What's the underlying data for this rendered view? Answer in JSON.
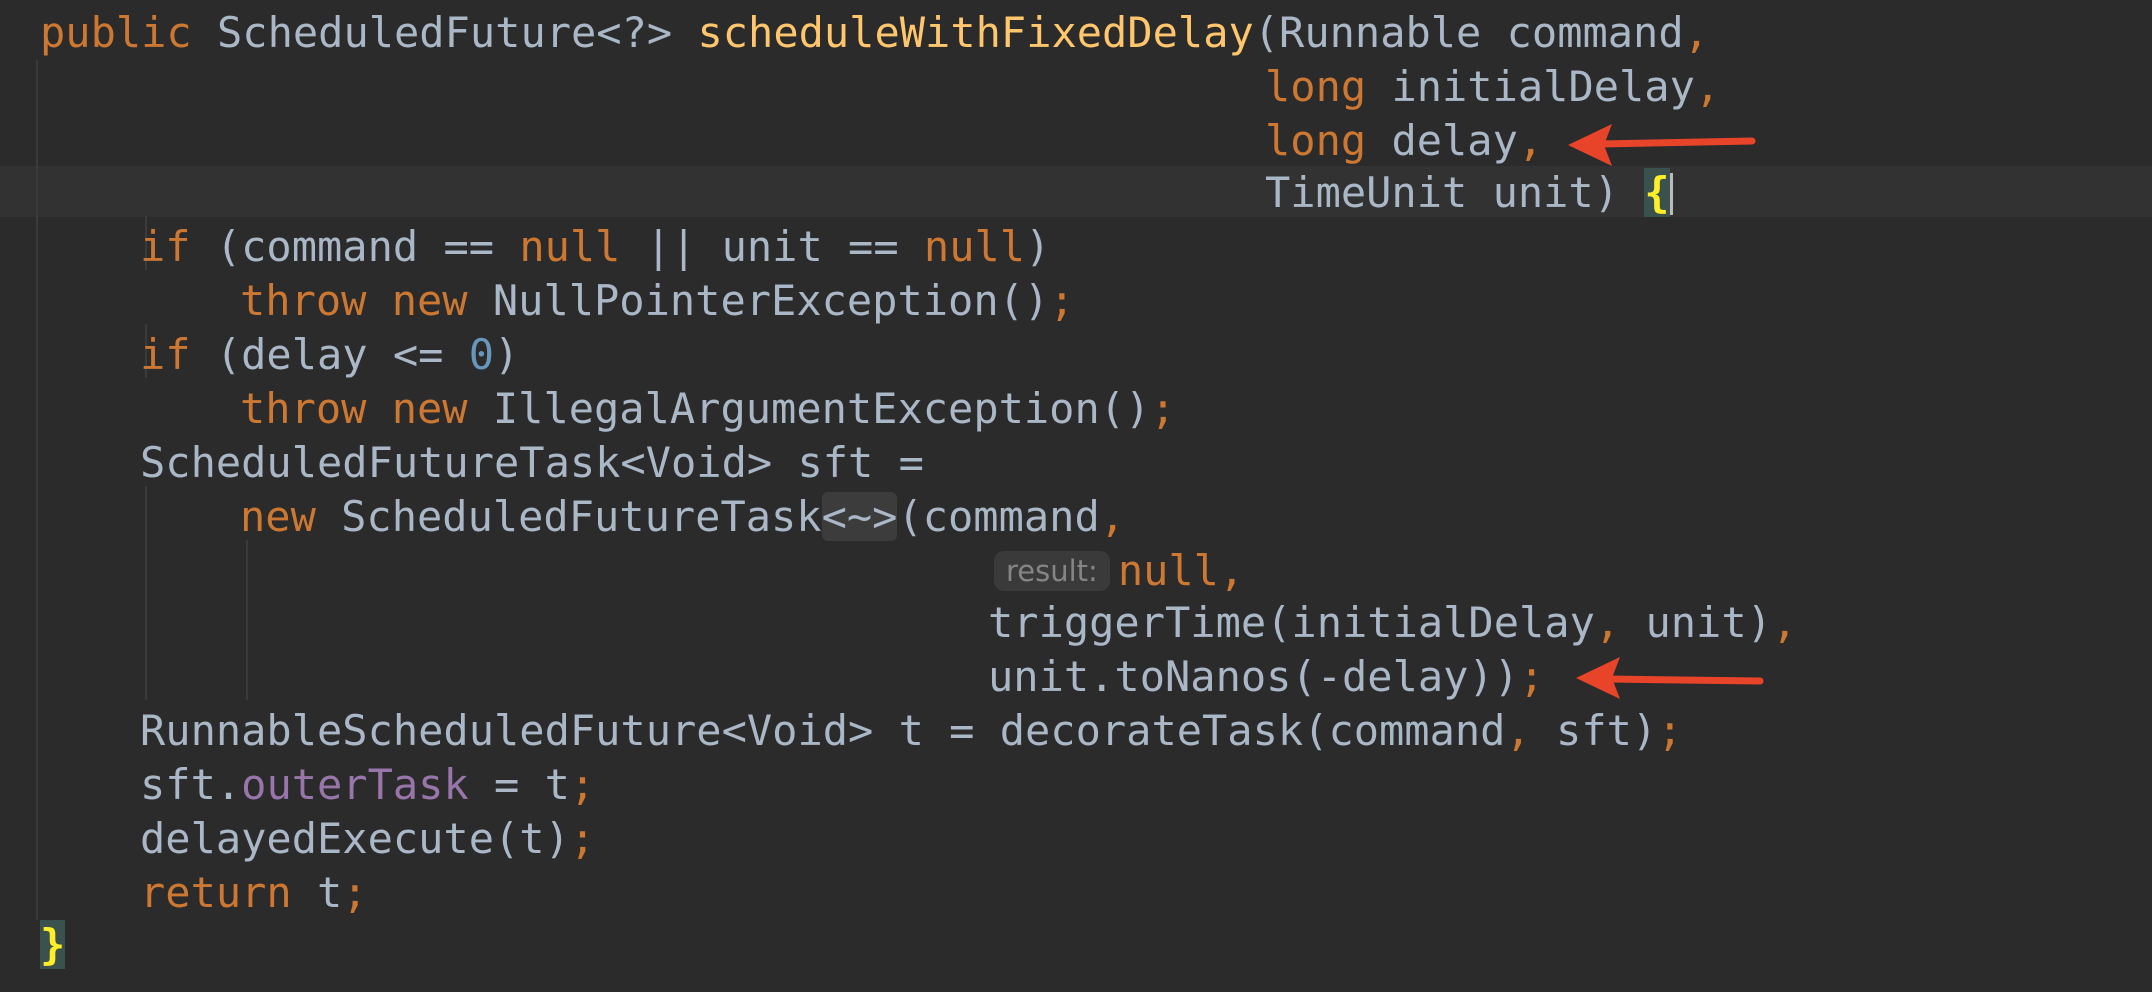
{
  "code": {
    "l1": {
      "kw_public": "public",
      "ret_type": "ScheduledFuture<?>",
      "method": "scheduleWithFixedDelay",
      "open": "(Runnable command",
      "comma": ","
    },
    "l2": {
      "kw": "long",
      "param": " initialDelay",
      "comma": ","
    },
    "l3": {
      "kw": "long",
      "param": " delay",
      "comma": ","
    },
    "l4": {
      "text": "TimeUnit unit) ",
      "brace": "{"
    },
    "l5": {
      "kw_if": "if",
      "p1": " (command == ",
      "null1": "null",
      "p2": " || unit == ",
      "null2": "null",
      "p3": ")"
    },
    "l6": {
      "kw_throw": "throw",
      "kw_new": "new",
      "text": " NullPointerException()",
      "semi": ";"
    },
    "l7": {
      "kw_if": "if",
      "p1": " (delay <= ",
      "zero": "0",
      "p2": ")"
    },
    "l8": {
      "kw_throw": "throw",
      "kw_new": "new",
      "text": " IllegalArgumentException()",
      "semi": ";"
    },
    "l9": {
      "text": "ScheduledFutureTask<Void> sft ="
    },
    "l10": {
      "kw_new": "new",
      "text": " ScheduledFutureTask",
      "diamond": "<~>",
      "text2": "(command",
      "comma": ","
    },
    "l11": {
      "hint": "result:",
      "null": "null",
      "comma": ","
    },
    "l12": {
      "text": "triggerTime(initialDelay",
      "comma1": ",",
      "text2": " unit)",
      "comma2": ","
    },
    "l13": {
      "text": "unit.toNanos(-delay))",
      "semi": ";"
    },
    "l14": {
      "text": "RunnableScheduledFuture<Void> t = decorateTask(command",
      "comma": ",",
      "text2": " sft)",
      "semi": ";"
    },
    "l15": {
      "obj": "sft.",
      "field": "outerTask",
      "text": " = t",
      "semi": ";"
    },
    "l16": {
      "text": "delayedExecute(t)",
      "semi": ";"
    },
    "l17": {
      "kw_return": "return",
      "text": " t",
      "semi": ";"
    },
    "l18": {
      "brace": "}"
    }
  },
  "colors": {
    "background": "#2b2b2b",
    "keyword": "#cc7832",
    "method": "#ffc66d",
    "number": "#6897bb",
    "field": "#9876aa",
    "default_text": "#a9b7c6",
    "arrow": "#e8442a"
  }
}
